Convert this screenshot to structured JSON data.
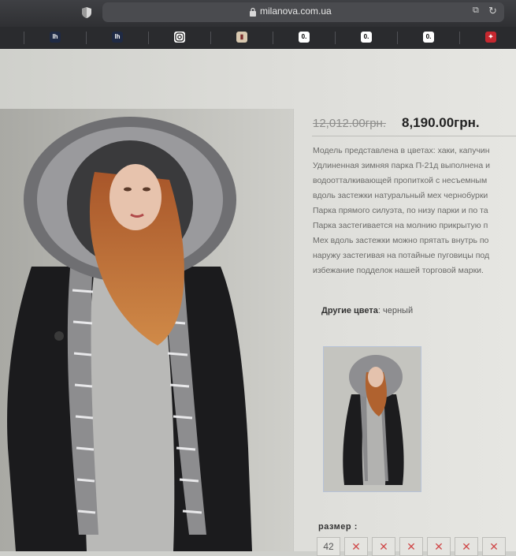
{
  "browser": {
    "url": "milanova.com.ua",
    "bookmarks": [
      {
        "icon": "lh",
        "bg": "#1f2a44",
        "fg": "#ffffff"
      },
      {
        "icon": "lh",
        "bg": "#1f2a44",
        "fg": "#ffffff"
      },
      {
        "icon": "instagram",
        "bg": "#ffffff",
        "fg": "#333333"
      },
      {
        "icon": "doc",
        "bg": "#d9c9b0",
        "fg": "#7a2c2c"
      },
      {
        "icon": "0.",
        "bg": "#ffffff",
        "fg": "#000000"
      },
      {
        "icon": "0.",
        "bg": "#ffffff",
        "fg": "#000000"
      },
      {
        "icon": "0.",
        "bg": "#ffffff",
        "fg": "#000000"
      },
      {
        "icon": "gift",
        "bg": "#c6282f",
        "fg": "#ffffff"
      }
    ]
  },
  "product": {
    "old_price": "12,012.00грн.",
    "new_price": "8,190.00грн.",
    "description_lines": [
      "Модель представлена в цветах: хаки, капучин",
      "Удлиненная зимняя парка П-21д выполнена и",
      "водоотталкивающей пропиткой с несъемным",
      "вдоль застежки натуральный мех чернобурки",
      "Парка прямого силуэта, по низу парки и по та",
      "Парка застегивается на молнию прикрытую п",
      "Мех вдоль застежки можно прятать внутрь по",
      "наружу застегивая на потайные пуговицы под",
      "избежание подделок нашей торговой марки."
    ],
    "other_colors_label": "Другие цвета",
    "other_colors_value": ": черный",
    "size_label": "размер :",
    "sizes": [
      {
        "label": "42",
        "available": true
      },
      {
        "label": "✕",
        "available": false
      },
      {
        "label": "✕",
        "available": false
      },
      {
        "label": "✕",
        "available": false
      },
      {
        "label": "✕",
        "available": false
      },
      {
        "label": "✕",
        "available": false
      },
      {
        "label": "✕",
        "available": false
      }
    ]
  }
}
